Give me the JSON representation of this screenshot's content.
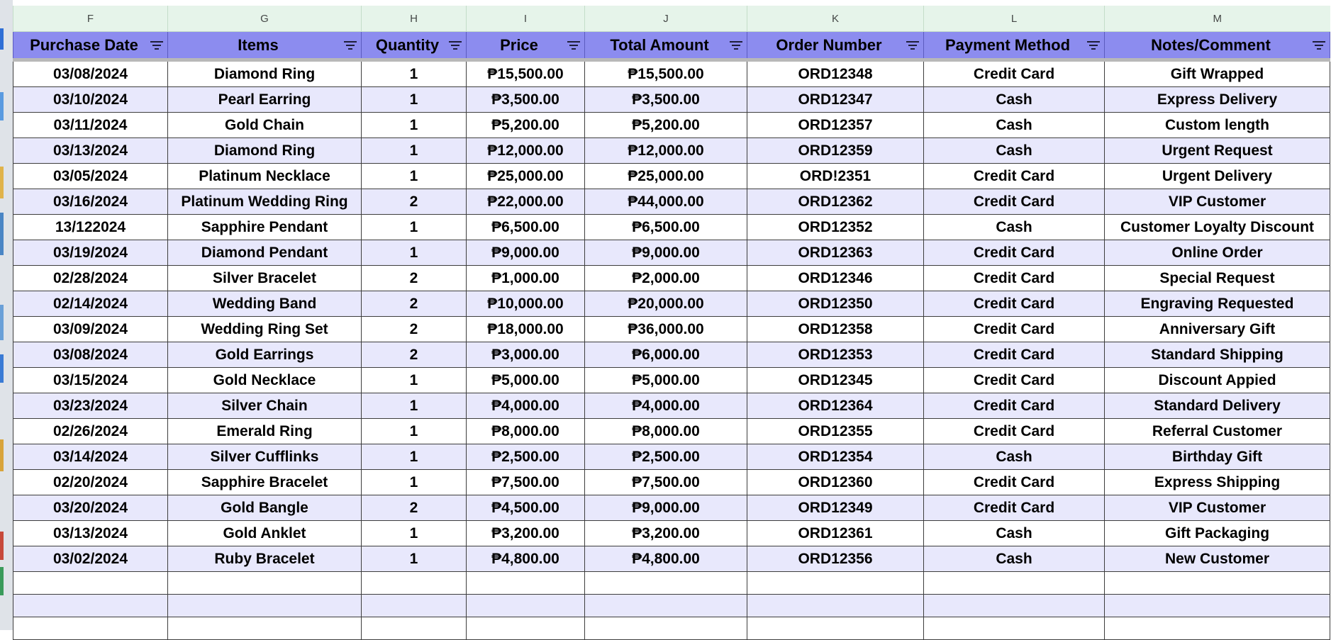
{
  "column_letters": [
    "F",
    "G",
    "H",
    "I",
    "J",
    "K",
    "L",
    "M"
  ],
  "headers": [
    "Purchase Date",
    "Items",
    "Quantity",
    "Price",
    "Total Amount",
    "Order Number",
    "Payment Method",
    "Notes/Comment"
  ],
  "rows": [
    [
      "03/08/2024",
      "Diamond Ring",
      "1",
      "₱15,500.00",
      "₱15,500.00",
      "ORD12348",
      "Credit Card",
      "Gift Wrapped"
    ],
    [
      "03/10/2024",
      "Pearl Earring",
      "1",
      "₱3,500.00",
      "₱3,500.00",
      "ORD12347",
      "Cash",
      "Express Delivery"
    ],
    [
      "03/11/2024",
      "Gold Chain",
      "1",
      "₱5,200.00",
      "₱5,200.00",
      "ORD12357",
      "Cash",
      "Custom length"
    ],
    [
      "03/13/2024",
      "Diamond Ring",
      "1",
      "₱12,000.00",
      "₱12,000.00",
      "ORD12359",
      "Cash",
      "Urgent Request"
    ],
    [
      "03/05/2024",
      "Platinum Necklace",
      "1",
      "₱25,000.00",
      "₱25,000.00",
      "ORD!2351",
      "Credit Card",
      "Urgent Delivery"
    ],
    [
      "03/16/2024",
      "Platinum Wedding Ring",
      "2",
      "₱22,000.00",
      "₱44,000.00",
      "ORD12362",
      "Credit Card",
      "VIP Customer"
    ],
    [
      "13/122024",
      "Sapphire Pendant",
      "1",
      "₱6,500.00",
      "₱6,500.00",
      "ORD12352",
      "Cash",
      "Customer Loyalty Discount"
    ],
    [
      "03/19/2024",
      "Diamond Pendant",
      "1",
      "₱9,000.00",
      "₱9,000.00",
      "ORD12363",
      "Credit Card",
      "Online Order"
    ],
    [
      "02/28/2024",
      "Silver Bracelet",
      "2",
      "₱1,000.00",
      "₱2,000.00",
      "ORD12346",
      "Credit Card",
      "Special Request"
    ],
    [
      "02/14/2024",
      "Wedding Band",
      "2",
      "₱10,000.00",
      "₱20,000.00",
      "ORD12350",
      "Credit Card",
      "Engraving Requested"
    ],
    [
      "03/09/2024",
      "Wedding Ring Set",
      "2",
      "₱18,000.00",
      "₱36,000.00",
      "ORD12358",
      "Credit Card",
      "Anniversary Gift"
    ],
    [
      "03/08/2024",
      "Gold Earrings",
      "2",
      "₱3,000.00",
      "₱6,000.00",
      "ORD12353",
      "Credit Card",
      "Standard Shipping"
    ],
    [
      "03/15/2024",
      "Gold Necklace",
      "1",
      "₱5,000.00",
      "₱5,000.00",
      "ORD12345",
      "Credit Card",
      "Discount Appied"
    ],
    [
      "03/23/2024",
      "Silver Chain",
      "1",
      "₱4,000.00",
      "₱4,000.00",
      "ORD12364",
      "Credit Card",
      "Standard Delivery"
    ],
    [
      "02/26/2024",
      "Emerald Ring",
      "1",
      "₱8,000.00",
      "₱8,000.00",
      "ORD12355",
      "Credit Card",
      "Referral Customer"
    ],
    [
      "03/14/2024",
      "Silver Cufflinks",
      "1",
      "₱2,500.00",
      "₱2,500.00",
      "ORD12354",
      "Cash",
      "Birthday Gift"
    ],
    [
      "02/20/2024",
      "Sapphire Bracelet",
      "1",
      "₱7,500.00",
      "₱7,500.00",
      "ORD12360",
      "Credit Card",
      "Express Shipping"
    ],
    [
      "03/20/2024",
      "Gold Bangle",
      "2",
      "₱4,500.00",
      "₱9,000.00",
      "ORD12349",
      "Credit Card",
      "VIP Customer"
    ],
    [
      "03/13/2024",
      "Gold Anklet",
      "1",
      "₱3,200.00",
      "₱3,200.00",
      "ORD12361",
      "Cash",
      "Gift Packaging"
    ],
    [
      "03/02/2024",
      "Ruby Bracelet",
      "1",
      "₱4,800.00",
      "₱4,800.00",
      "ORD12356",
      "Cash",
      "New Customer"
    ]
  ],
  "colors": {
    "header_bg": "#8c8cef",
    "column_letter_bg": "#e6f4ea",
    "banded_row_bg": "#e8e8fc",
    "row_bg": "#ffffff"
  }
}
